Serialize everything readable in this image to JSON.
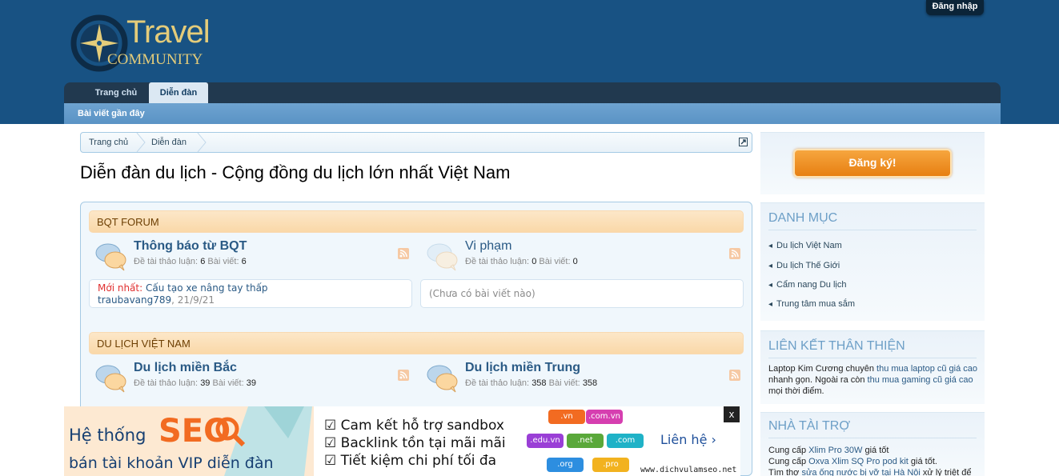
{
  "header": {
    "logo_line1": "Travel",
    "logo_line2": "COMMUNITY",
    "login_label": "Đăng nhập"
  },
  "nav": {
    "tabs": [
      "Trang chủ",
      "Diễn đàn"
    ],
    "active_tab": "Diễn đàn",
    "sub_items": [
      "Bài viết gần đây"
    ]
  },
  "breadcrumb": [
    "Trang chủ",
    "Diễn đàn"
  ],
  "page_title": "Diễn đàn du lịch - Cộng đồng du lịch lớn nhất Việt Nam",
  "categories": [
    {
      "title": "BQT FORUM",
      "nodes": [
        {
          "title": "Thông báo từ BQT",
          "threads_label": "Đề tài thảo luận:",
          "threads": "6",
          "posts_label": "Bài viết:",
          "posts": "6",
          "last_post_prefix": "Mới nhất:",
          "last_post_title": "Cấu tạo xe nâng tay thấp",
          "last_post_user": "traubavang789",
          "last_post_date": "21/9/21"
        },
        {
          "title": "Vi phạm",
          "threads_label": "Đề tài thảo luận:",
          "threads": "0",
          "posts_label": "Bài viết:",
          "posts": "0",
          "empty_text": "(Chưa có bài viết nào)"
        }
      ]
    },
    {
      "title": "DU LỊCH VIỆT NAM",
      "nodes": [
        {
          "title": "Du lịch miền Bắc",
          "threads_label": "Đề tài thảo luận:",
          "threads": "39",
          "posts_label": "Bài viết:",
          "posts": "39"
        },
        {
          "title": "Du lịch miền Trung",
          "threads_label": "Đề tài thảo luận:",
          "threads": "358",
          "posts_label": "Bài viết:",
          "posts": "358"
        }
      ]
    }
  ],
  "sidebar": {
    "register_label": "Đăng ký!",
    "categories_heading": "DANH MỤC",
    "categories": [
      "Du lịch Việt Nam",
      "Du lịch Thế Giới",
      "Cẩm nang Du lịch",
      "Trung tâm mua sắm"
    ],
    "links_heading": "LIÊN KẾT THÂN THIỆN",
    "links_text": {
      "p1": "Laptop Kim Cương chuyên ",
      "l1": "thu mua laptop cũ giá cao",
      "p2": " nhanh gọn. Ngoài ra còn ",
      "l2": "thu mua gaming cũ giá cao",
      "p3": " mọi thời điểm."
    },
    "sponsor_heading": "NHÀ TÀI TRỢ",
    "sponsor_lines": [
      {
        "pre": "Cung cấp ",
        "link": "Xlim Pro 30W",
        "post": " giá tốt"
      },
      {
        "pre": "Cung cấp ",
        "link": "Oxva Xlim SQ Pro pod kit",
        "post": " giá tốt."
      },
      {
        "pre": "Tìm thợ ",
        "link": "sửa ống nước bị vỡ tại Hà Nội",
        "post": " xử lý triệt để"
      }
    ]
  },
  "ad": {
    "line1": "Hệ thống",
    "seo": "SEO",
    "line2": "bán tài khoản VIP diễn đàn",
    "checks": [
      "Cam kết hỗ trợ sandbox",
      "Backlink tồn tại mãi mãi",
      "Tiết kiệm chi phí tối đa"
    ],
    "domains": [
      ".vn",
      ".com.vn",
      ".edu.vn",
      ".net",
      ".com",
      ".org",
      ".pro"
    ],
    "cta": "Liên hệ ›",
    "site": "www.dichvulamseo.net",
    "close": "x"
  },
  "colors": {
    "header_bg": "#185283",
    "category_head": "#fad8a8",
    "link": "#2a5a85",
    "register": "#e77f12"
  }
}
